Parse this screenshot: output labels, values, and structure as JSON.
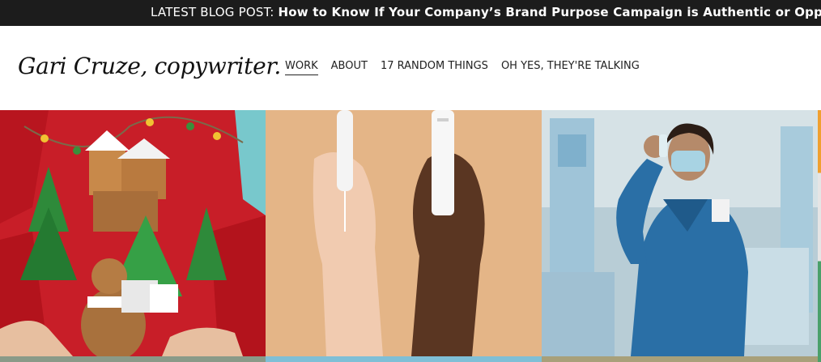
{
  "announcement": {
    "prefix": "LATEST BLOG POST:",
    "link_text": "How to Know If Your Company’s Brand Purpose Campaign is Authentic or Opportunistic"
  },
  "header": {
    "logo_text": "Gari Cruze, copywriter."
  },
  "nav": {
    "items": [
      {
        "label": "WORK",
        "active": true
      },
      {
        "label": "ABOUT",
        "active": false
      },
      {
        "label": "17 RANDOM THINGS",
        "active": false
      },
      {
        "label": "OH YES, THEY'RE TALKING",
        "active": false
      }
    ]
  },
  "portfolio": {
    "tiles": [
      {
        "subject": "ugly christmas sweater"
      },
      {
        "subject": "hands holding tampons"
      },
      {
        "subject": "nurse holding vial"
      }
    ]
  },
  "colors": {
    "announcement_bg": "#1c1c1c",
    "sweater_red": "#c81e28",
    "tampon_bg": "#e6b88a",
    "hospital_blue": "#6fa6c6"
  }
}
